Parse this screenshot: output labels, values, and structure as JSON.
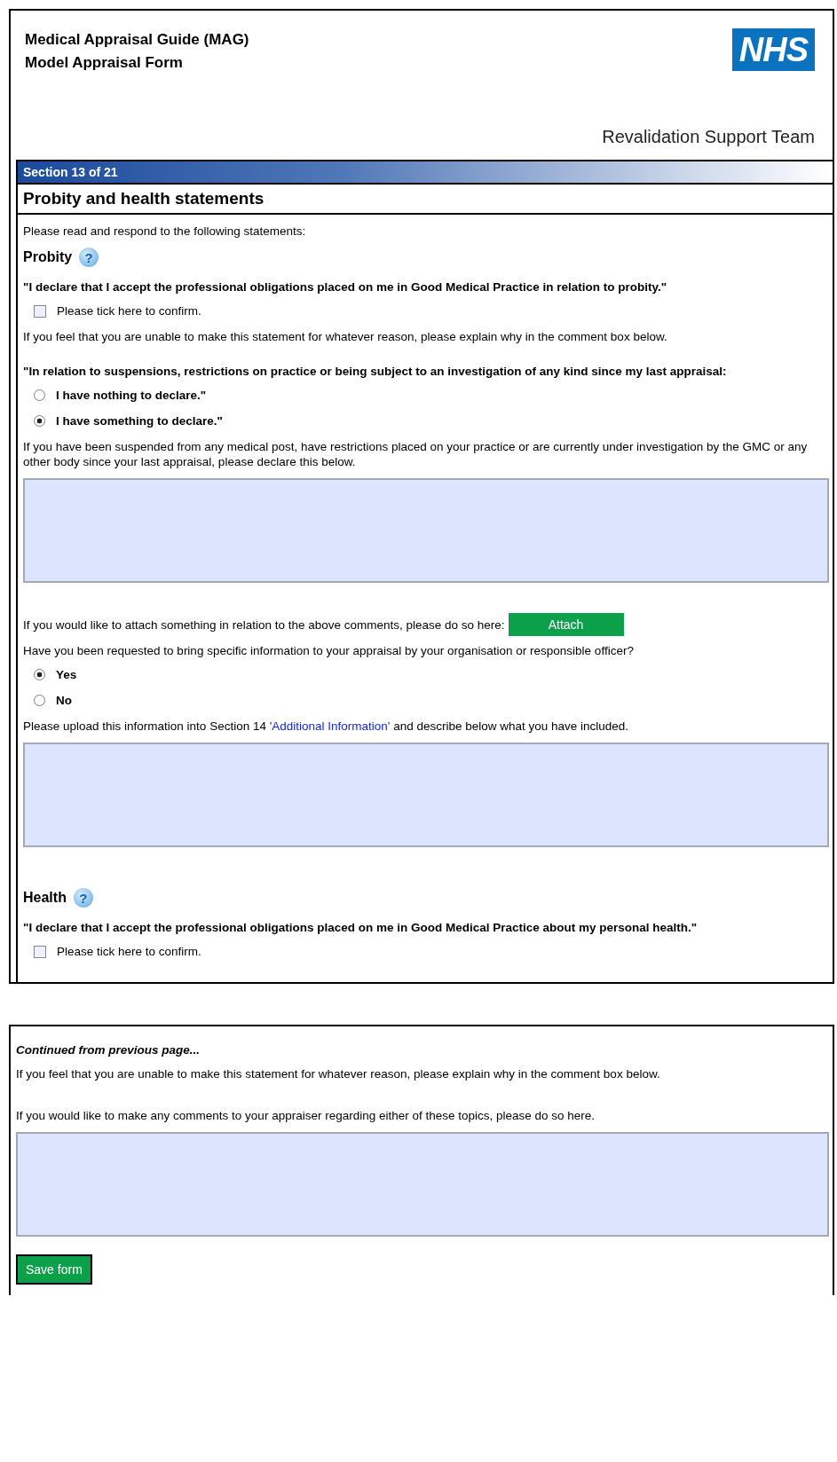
{
  "header": {
    "title_lines": [
      "Medical Appraisal Guide (MAG)",
      "Model Appraisal Form"
    ],
    "logo": "NHS",
    "team": "Revalidation Support Team"
  },
  "section": {
    "label": "Section  13 of 21",
    "title": "Probity and health statements"
  },
  "intro": "Please read and respond to the following statements:",
  "probity": {
    "heading": "Probity",
    "help_icon": "?",
    "statement": "\"I declare that I accept the professional obligations placed on me in Good Medical Practice in relation to probity.\"",
    "confirm": {
      "label": "Please tick here to confirm.",
      "checked": false
    },
    "unable_note": "If you feel that you are unable to make this statement for whatever reason, please explain why in the comment box below.",
    "statement2": "\"In relation to suspensions, restrictions on practice or being subject to an investigation of any kind since my last appraisal:",
    "options": [
      {
        "label": "I have nothing to declare.\"",
        "selected": false
      },
      {
        "label": "I have something to declare.\"",
        "selected": true
      }
    ],
    "declare_prompt": "If you have been suspended from any medical post, have restrictions placed on your practice or are currently under investigation by the GMC or any other body since your last appraisal, please declare this below."
  },
  "attach": {
    "prompt": "If you would like to attach something in relation to the above comments, please do so here:",
    "button": "Attach"
  },
  "request": {
    "question": "Have you been requested to bring specific information to your appraisal by your organisation or responsible officer?",
    "options": [
      {
        "label": "Yes",
        "selected": true
      },
      {
        "label": "No",
        "selected": false
      }
    ],
    "upload_before": "Please upload this information into Section 14 ",
    "upload_link": "'Additional Information'",
    "upload_after": " and describe below what you have included."
  },
  "health": {
    "heading": "Health",
    "help_icon": "?",
    "statement": "\"I declare that I accept the professional obligations placed on me in Good Medical Practice about my personal health.\"",
    "confirm": {
      "label": "Please tick here to confirm.",
      "checked": false
    }
  },
  "continued": {
    "note": "Continued from previous page...",
    "unable_note": "If you feel that you are unable to make this statement for whatever reason, please explain why in the comment box below.",
    "comments_prompt": "If you would like to make any comments to your appraiser regarding either of these topics, please do so here.",
    "save_button": "Save form"
  }
}
